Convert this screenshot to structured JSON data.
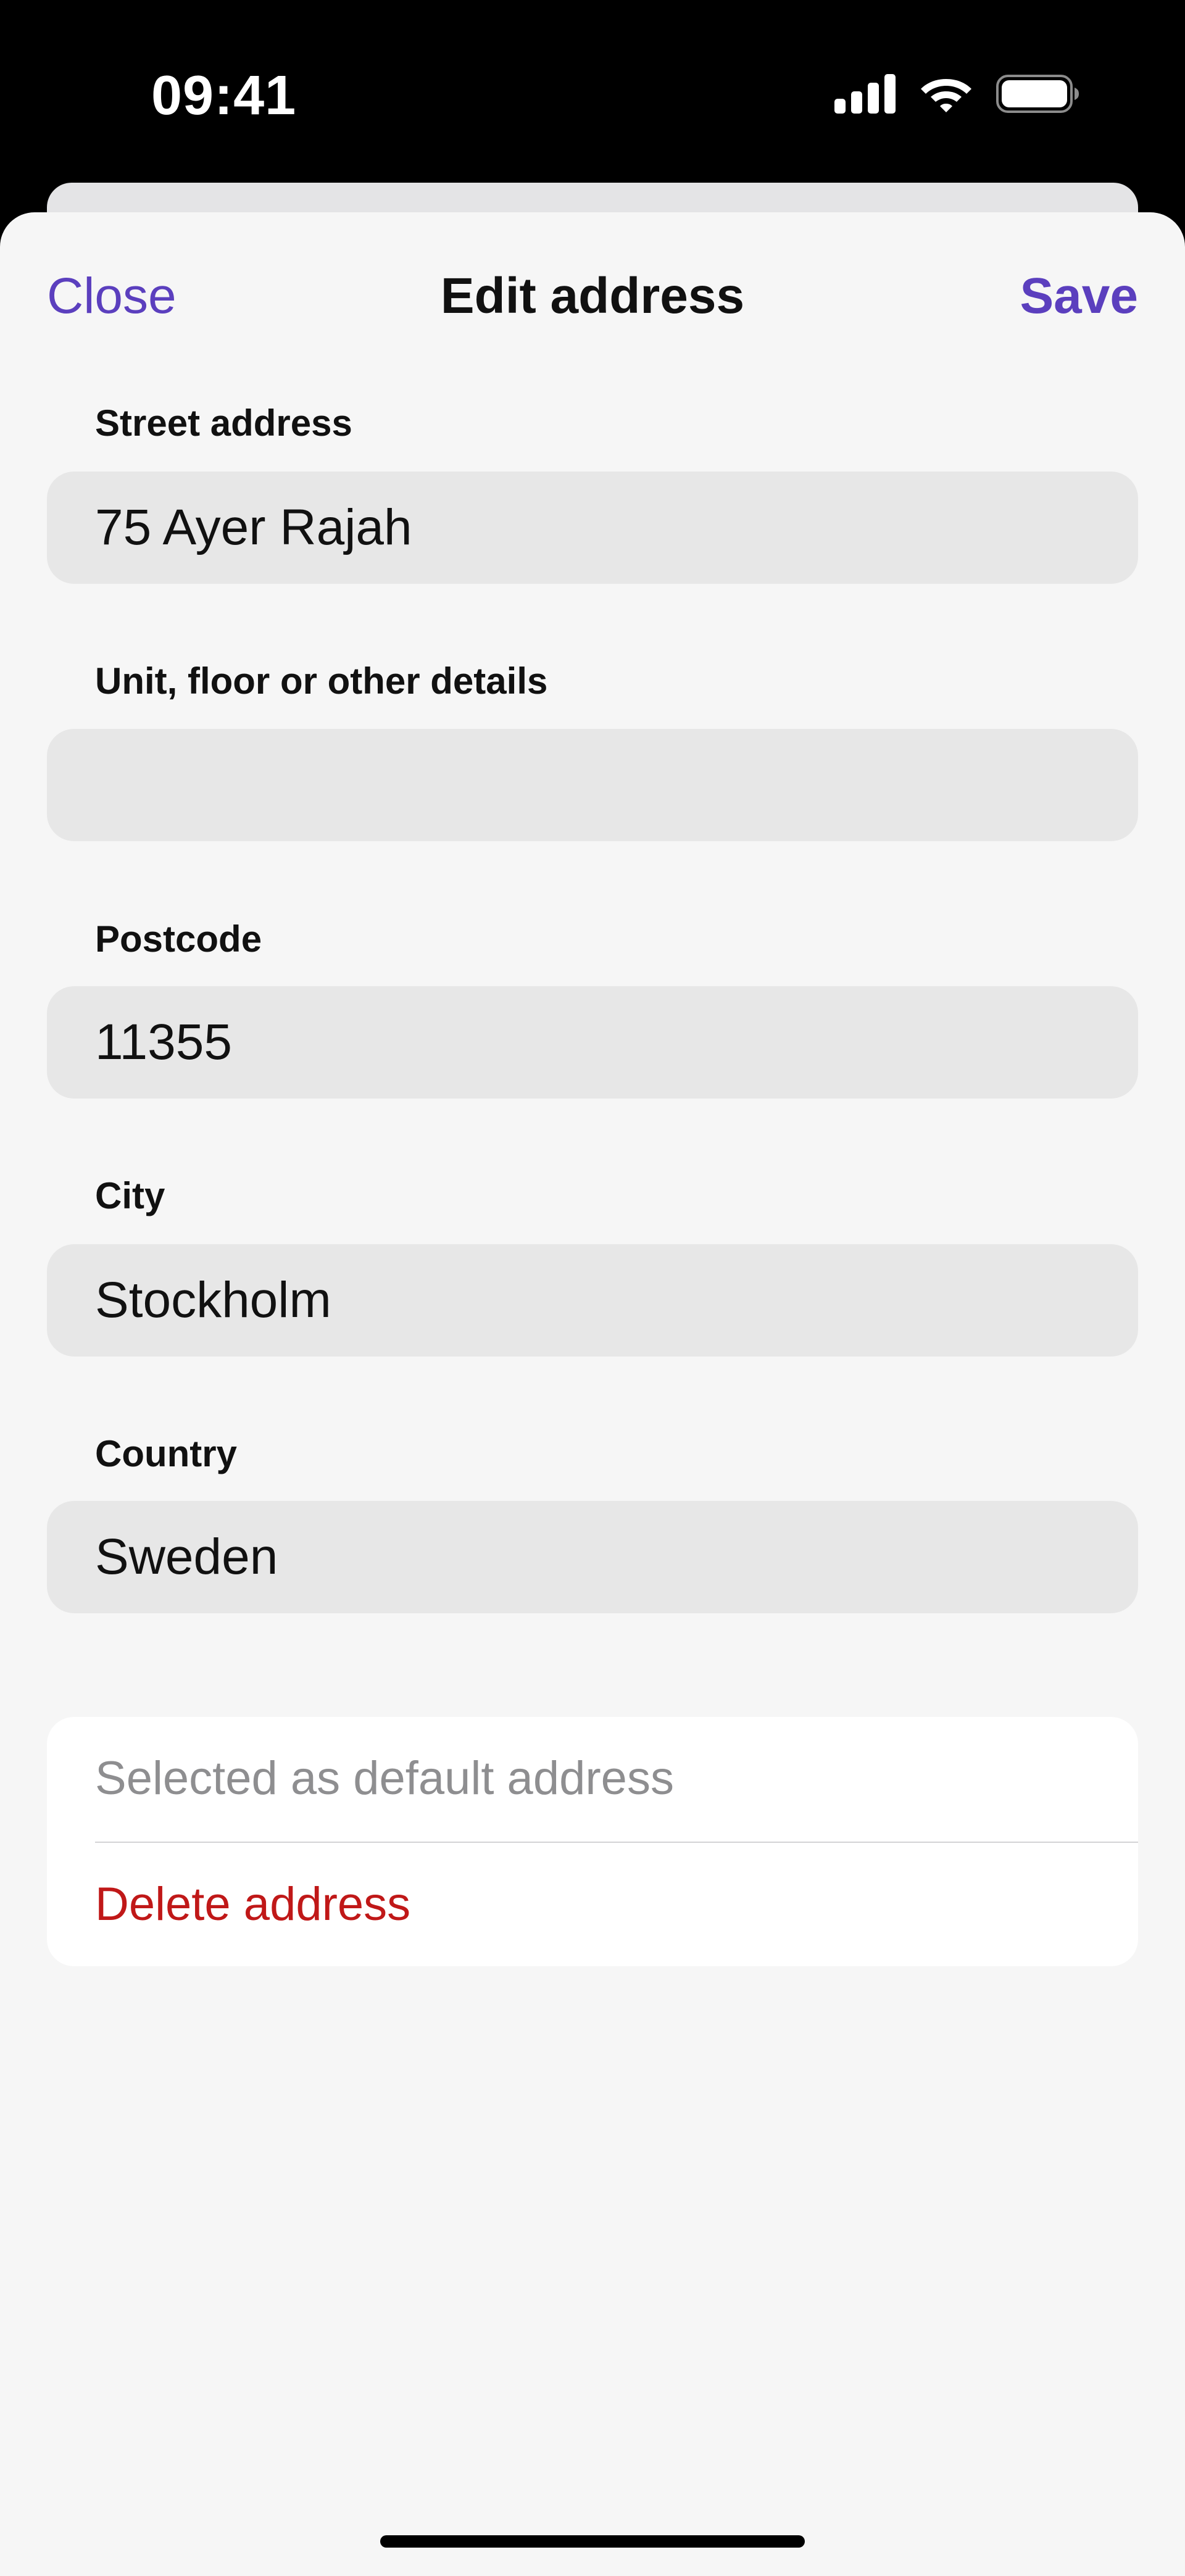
{
  "status_bar": {
    "time": "09:41",
    "icons": [
      "cellular-signal-icon",
      "wifi-icon",
      "battery-icon"
    ]
  },
  "nav": {
    "close_label": "Close",
    "title": "Edit address",
    "save_label": "Save"
  },
  "form": {
    "fields": [
      {
        "label": "Street address",
        "value": "75 Ayer Rajah"
      },
      {
        "label": "Unit, floor or other details",
        "value": ""
      },
      {
        "label": "Postcode",
        "value": "11355"
      },
      {
        "label": "City",
        "value": "Stockholm"
      },
      {
        "label": "Country",
        "value": "Sweden"
      }
    ]
  },
  "actions": {
    "default_status": "Selected as default address",
    "delete_label": "Delete address"
  },
  "colors": {
    "accent": "#5b3fbe",
    "destructive": "#c01818",
    "sheet_background": "#f6f6f6",
    "field_background": "#e7e7e7"
  }
}
